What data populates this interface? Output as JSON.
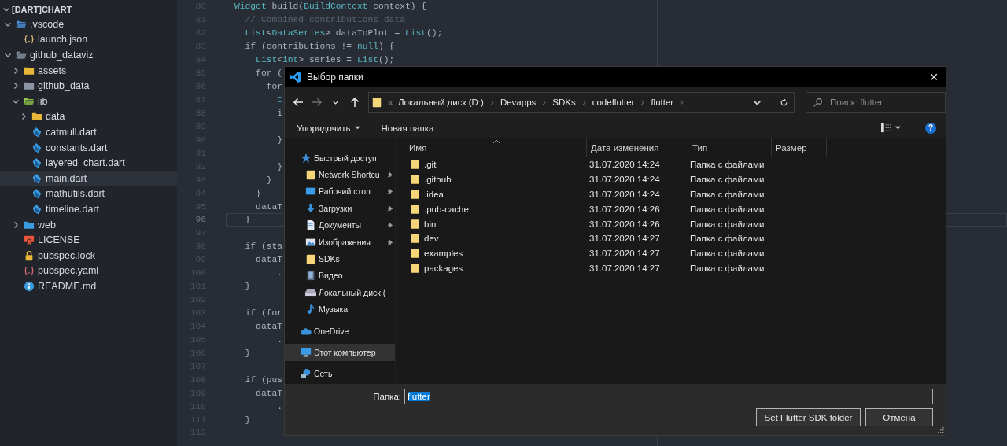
{
  "explorer": {
    "title": "[DART]CHART",
    "expanded": true,
    "items": [
      {
        "label": ".vscode",
        "kind": "vscode",
        "expanded": true,
        "selected": false,
        "children": [
          {
            "label": "launch.json",
            "kind": "json",
            "selected": false
          }
        ]
      },
      {
        "label": "github_dataviz",
        "kind": "folder",
        "expanded": true,
        "selected": false,
        "children": [
          {
            "label": "assets",
            "kind": "assets",
            "expanded": false,
            "selected": false
          },
          {
            "label": "github_data",
            "kind": "folder",
            "expanded": false,
            "selected": false
          },
          {
            "label": "lib",
            "kind": "lib",
            "expanded": true,
            "selected": false,
            "children": [
              {
                "label": "data",
                "kind": "data",
                "expanded": false,
                "selected": false
              },
              {
                "label": "catmull.dart",
                "kind": "dart",
                "selected": false
              },
              {
                "label": "constants.dart",
                "kind": "dart",
                "selected": false
              },
              {
                "label": "layered_chart.dart",
                "kind": "dart",
                "selected": false
              },
              {
                "label": "main.dart",
                "kind": "dart",
                "selected": true
              },
              {
                "label": "mathutils.dart",
                "kind": "dart",
                "selected": false
              },
              {
                "label": "timeline.dart",
                "kind": "dart",
                "selected": false
              }
            ]
          },
          {
            "label": "web",
            "kind": "web",
            "expanded": false,
            "selected": false
          },
          {
            "label": "LICENSE",
            "kind": "license",
            "selected": false
          },
          {
            "label": "pubspec.lock",
            "kind": "lock",
            "selected": false
          },
          {
            "label": "pubspec.yaml",
            "kind": "yaml",
            "selected": false
          },
          {
            "label": "README.md",
            "kind": "readme",
            "selected": false
          }
        ]
      }
    ]
  },
  "editor": {
    "lines": [
      {
        "number": "80",
        "current": false,
        "tokens": [
          {
            "text": "Widget",
            "kind": "type"
          },
          {
            "text": " build(",
            "kind": "plain"
          },
          {
            "text": "BuildContext",
            "kind": "type"
          },
          {
            "text": " context) {",
            "kind": "plain"
          }
        ]
      },
      {
        "number": "81",
        "current": false,
        "tokens": [
          {
            "text": "  // Combined contributions data",
            "kind": "comment"
          }
        ]
      },
      {
        "number": "82",
        "current": false,
        "tokens": [
          {
            "text": "  List",
            "kind": "type"
          },
          {
            "text": "<",
            "kind": "plain"
          },
          {
            "text": "DataSeries",
            "kind": "type"
          },
          {
            "text": "> dataToPlot = ",
            "kind": "plain"
          },
          {
            "text": "List",
            "kind": "type"
          },
          {
            "text": "();",
            "kind": "plain"
          }
        ]
      },
      {
        "number": "83",
        "current": false,
        "tokens": [
          {
            "text": "  if (contributions != ",
            "kind": "plain"
          },
          {
            "text": "null",
            "kind": "type"
          },
          {
            "text": ") {",
            "kind": "plain"
          }
        ]
      },
      {
        "number": "84",
        "current": false,
        "tokens": [
          {
            "text": "    List",
            "kind": "type"
          },
          {
            "text": "<",
            "kind": "plain"
          },
          {
            "text": "int",
            "kind": "type"
          },
          {
            "text": "> series = ",
            "kind": "plain"
          },
          {
            "text": "List",
            "kind": "type"
          },
          {
            "text": "();",
            "kind": "plain"
          }
        ]
      },
      {
        "number": "85",
        "current": false,
        "tokens": [
          {
            "text": "    for (",
            "kind": "plain"
          }
        ]
      },
      {
        "number": "86",
        "current": false,
        "tokens": [
          {
            "text": "      for",
            "kind": "plain"
          }
        ]
      },
      {
        "number": "87",
        "current": false,
        "tokens": [
          {
            "text": "        C",
            "kind": "type"
          }
        ]
      },
      {
        "number": "88",
        "current": false,
        "tokens": [
          {
            "text": "        i",
            "kind": "plain"
          }
        ]
      },
      {
        "number": "89",
        "current": false
      },
      {
        "number": "90",
        "current": false,
        "tokens": [
          {
            "text": "        }",
            "kind": "plain"
          }
        ]
      },
      {
        "number": "91",
        "current": false
      },
      {
        "number": "92",
        "current": false,
        "tokens": [
          {
            "text": "        }",
            "kind": "plain"
          }
        ]
      },
      {
        "number": "93",
        "current": false,
        "tokens": [
          {
            "text": "      }",
            "kind": "plain"
          }
        ]
      },
      {
        "number": "94",
        "current": false,
        "tokens": [
          {
            "text": "    }",
            "kind": "plain"
          }
        ]
      },
      {
        "number": "95",
        "current": false,
        "tokens": [
          {
            "text": "    dataT",
            "kind": "plain"
          }
        ]
      },
      {
        "number": "96",
        "current": true,
        "tokens": [
          {
            "text": "  }",
            "kind": "plain"
          }
        ]
      },
      {
        "number": "97",
        "current": false
      },
      {
        "number": "98",
        "current": false,
        "tokens": [
          {
            "text": "  if (sta",
            "kind": "plain"
          }
        ]
      },
      {
        "number": "99",
        "current": false,
        "tokens": [
          {
            "text": "    dataT",
            "kind": "plain"
          }
        ]
      },
      {
        "number": "100",
        "current": false,
        "tokens": [
          {
            "text": "        .",
            "kind": "plain"
          }
        ]
      },
      {
        "number": "101",
        "current": false,
        "tokens": [
          {
            "text": "  }",
            "kind": "plain"
          }
        ]
      },
      {
        "number": "102",
        "current": false
      },
      {
        "number": "103",
        "current": false,
        "tokens": [
          {
            "text": "  if (for",
            "kind": "plain"
          }
        ]
      },
      {
        "number": "104",
        "current": false,
        "tokens": [
          {
            "text": "    dataT",
            "kind": "plain"
          }
        ]
      },
      {
        "number": "105",
        "current": false,
        "tokens": [
          {
            "text": "        .",
            "kind": "plain"
          }
        ]
      },
      {
        "number": "106",
        "current": false,
        "tokens": [
          {
            "text": "  }",
            "kind": "plain"
          }
        ]
      },
      {
        "number": "107",
        "current": false
      },
      {
        "number": "108",
        "current": false,
        "tokens": [
          {
            "text": "  if (pus",
            "kind": "plain"
          }
        ]
      },
      {
        "number": "109",
        "current": false,
        "tokens": [
          {
            "text": "    dataT",
            "kind": "plain"
          }
        ]
      },
      {
        "number": "110",
        "current": false,
        "tokens": [
          {
            "text": "        .",
            "kind": "plain"
          }
        ]
      },
      {
        "number": "111",
        "current": false,
        "tokens": [
          {
            "text": "  }",
            "kind": "plain"
          }
        ]
      },
      {
        "number": "112",
        "current": false
      }
    ]
  },
  "dialog": {
    "title": "Выбор папки",
    "close": "✕",
    "nav_buttons": [
      {
        "kind": "back",
        "disabled": false
      },
      {
        "kind": "forward",
        "disabled": true
      },
      {
        "kind": "recent",
        "disabled": false
      },
      {
        "kind": "up",
        "disabled": false
      }
    ],
    "address": {
      "overflow": "«",
      "crumbs": [
        "Локальный диск (D:)",
        "Devapps",
        "SDKs",
        "codeflutter",
        "flutter"
      ]
    },
    "search": {
      "placeholder": "Поиск: flutter"
    },
    "toolbar": {
      "organize": "Упорядочить",
      "new_folder": "Новая папка",
      "help": "?"
    },
    "nav_pane": [
      {
        "label": "Быстрый доступ",
        "kind": "star",
        "selected": false,
        "children": [
          {
            "label": "Network Shortcu",
            "kind": "folder",
            "pinned": true,
            "selected": false
          },
          {
            "label": "Рабочий стол",
            "kind": "desktop",
            "pinned": true,
            "selected": false
          },
          {
            "label": "Загрузки",
            "kind": "download",
            "pinned": true,
            "selected": false
          },
          {
            "label": "Документы",
            "kind": "document",
            "pinned": true,
            "selected": false
          },
          {
            "label": "Изображения",
            "kind": "image",
            "pinned": true,
            "selected": false
          },
          {
            "label": "SDKs",
            "kind": "folder",
            "pinned": false,
            "selected": false
          },
          {
            "label": "Видео",
            "kind": "video",
            "pinned": false,
            "selected": false
          },
          {
            "label": "Локальный диск (",
            "kind": "drive",
            "pinned": false,
            "selected": false
          },
          {
            "label": "Музыка",
            "kind": "music",
            "pinned": false,
            "selected": false
          }
        ]
      },
      {
        "label": "OneDrive",
        "kind": "cloud",
        "selected": false
      },
      {
        "label": "Этот компьютер",
        "kind": "computer",
        "selected": true
      },
      {
        "label": "Сеть",
        "kind": "network",
        "selected": false
      }
    ],
    "columns": [
      "Имя",
      "Дата изменения",
      "Тип",
      "Размер"
    ],
    "rows": [
      {
        "name": ".git",
        "modified": "31.07.2020 14:24",
        "type": "Папка с файлами",
        "selected": false
      },
      {
        "name": ".github",
        "modified": "31.07.2020 14:24",
        "type": "Папка с файлами",
        "selected": false
      },
      {
        "name": ".idea",
        "modified": "31.07.2020 14:24",
        "type": "Папка с файлами",
        "selected": false
      },
      {
        "name": ".pub-cache",
        "modified": "31.07.2020 14:26",
        "type": "Папка с файлами",
        "selected": false
      },
      {
        "name": "bin",
        "modified": "31.07.2020 14:26",
        "type": "Папка с файлами",
        "selected": false
      },
      {
        "name": "dev",
        "modified": "31.07.2020 14:27",
        "type": "Папка с файлами",
        "selected": false
      },
      {
        "name": "examples",
        "modified": "31.07.2020 14:27",
        "type": "Папка с файлами",
        "selected": false
      },
      {
        "name": "packages",
        "modified": "31.07.2020 14:27",
        "type": "Папка с файлами",
        "selected": false
      }
    ],
    "folder_field": {
      "label": "Папка:",
      "value": "flutter",
      "text_selected": true
    },
    "buttons": [
      "Set Flutter SDK folder",
      "Отмена"
    ]
  }
}
